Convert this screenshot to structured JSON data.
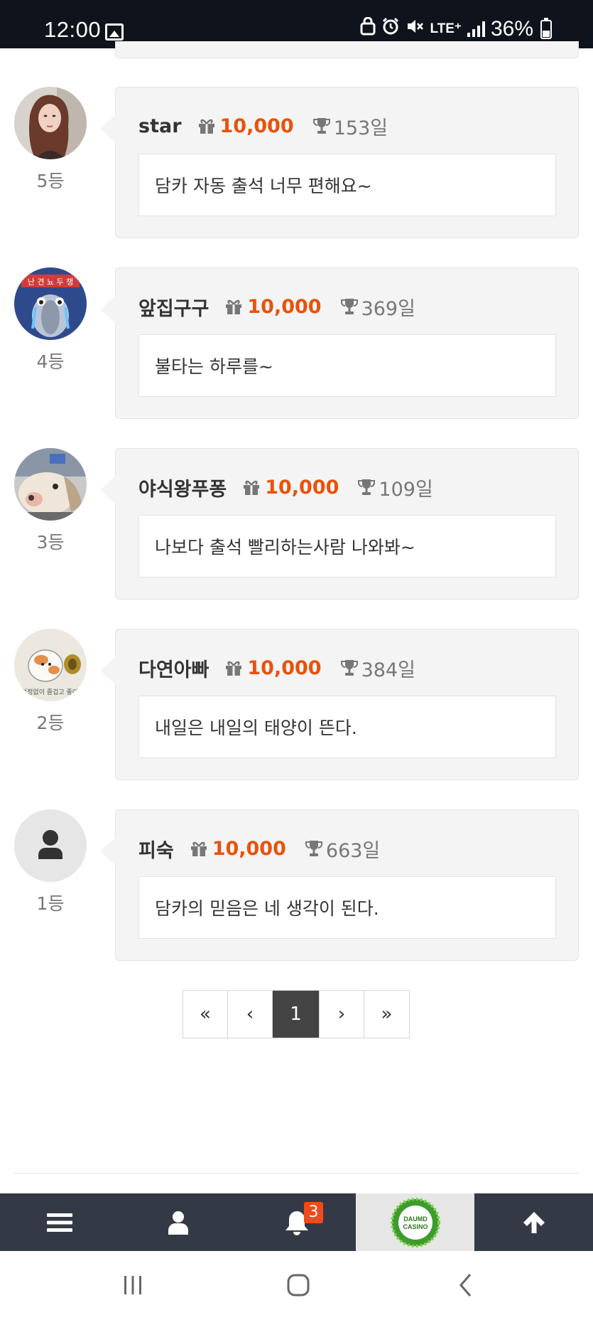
{
  "status_bar": {
    "time": "12:00",
    "network": "LTE⁺",
    "battery": "36%",
    "icons": [
      "gallery-icon",
      "vpn-icon",
      "alarm-icon",
      "mute-icon",
      "signal-icon",
      "battery-icon"
    ]
  },
  "comments": [
    {
      "name": "star",
      "points": "10,000",
      "days": "153일",
      "message": "담카 자동 출석 너무 편해요~",
      "rank": "5등",
      "avatar": "photo-woman"
    },
    {
      "name": "앞집구구",
      "points": "10,000",
      "days": "369일",
      "message": "불타는 하루를~",
      "rank": "4등",
      "avatar": "crying-character"
    },
    {
      "name": "야식왕푸퐁",
      "points": "10,000",
      "days": "109일",
      "message": "나보다 출석 빨리하는사람 나와봐~",
      "rank": "3등",
      "avatar": "dog-photo"
    },
    {
      "name": "다연아빠",
      "points": "10,000",
      "days": "384일",
      "message": "내일은 내일의 태양이 뜬다.",
      "rank": "2등",
      "avatar": "hamster-drawing"
    },
    {
      "name": "피숙",
      "points": "10,000",
      "days": "663일",
      "message": "담카의 믿음은 네 생각이 된다.",
      "rank": "1등",
      "avatar": "default-user"
    }
  ],
  "pagination": {
    "first": "«",
    "prev": "‹",
    "current": "1",
    "next": "›",
    "last": "»"
  },
  "bottom_nav": {
    "notification_count": "3",
    "logo_text_top": "DAUMD",
    "logo_text_bottom": "CASINO",
    "items": [
      "menu-icon",
      "user-icon",
      "bell-icon",
      "logo",
      "arrow-up-icon"
    ]
  },
  "colors": {
    "accent": "#e8520c",
    "nav_bg": "#333a45",
    "status_bg": "#0f141c",
    "badge": "#ef4b1d"
  }
}
